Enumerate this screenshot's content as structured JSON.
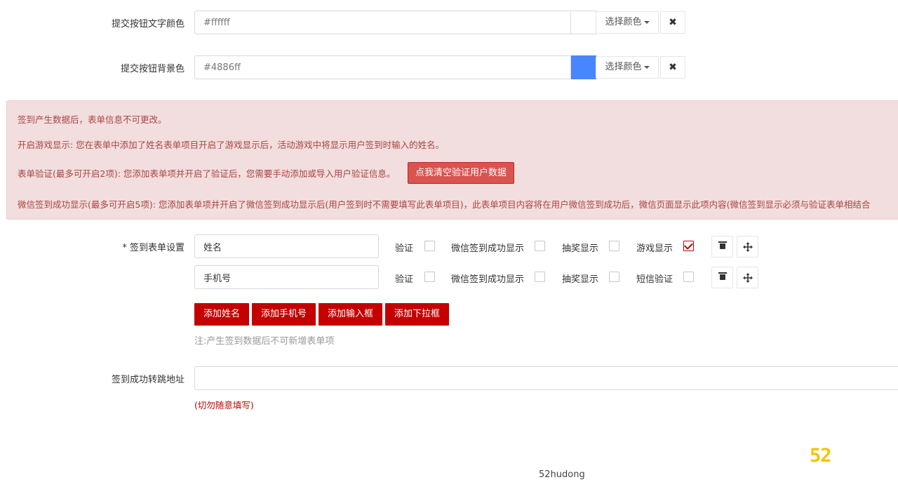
{
  "colors": {
    "accent": "#c40000",
    "alert_bg": "#f2dede",
    "alert_text": "#a94442",
    "clear_button": "#d9534f",
    "submit_text_swatch": "#ffffff",
    "submit_bg_swatch": "#4886ff",
    "logo": "#f5c400"
  },
  "submit_text_color": {
    "label": "提交按钮文字颜色",
    "value": "#ffffff",
    "pick_label": "选择颜色",
    "clear_icon": "close-icon"
  },
  "submit_bg_color": {
    "label": "提交按钮背景色",
    "value": "#4886ff",
    "pick_label": "选择颜色",
    "clear_icon": "close-icon"
  },
  "alert": {
    "line1": "签到产生数据后，表单信息不可更改。",
    "line2": "开启游戏显示: 您在表单中添加了姓名表单项目开启了游戏显示后，活动游戏中将显示用户签到时输入的姓名。",
    "line3": "表单验证(最多可开启2项): 您添加表单项并开启了验证后，您需要手动添加或导入用户验证信息。",
    "clear_button": "点我清空验证用户数据",
    "line4": "微信签到成功显示(最多可开启5项): 您添加表单项并开启了微信签到成功显示后(用户签到时不需要填写此表单项目)，此表单项目内容将在用户微信签到成功后，微信页面显示此项内容(微信签到显示必须与验证表单相结合"
  },
  "form_settings": {
    "label": "* 签到表单设置",
    "rows": [
      {
        "field": "姓名",
        "options": [
          {
            "label": "验证",
            "checked": false
          },
          {
            "label": "微信签到成功显示",
            "checked": false
          },
          {
            "label": "抽奖显示",
            "checked": false
          },
          {
            "label": "游戏显示",
            "checked": true
          }
        ]
      },
      {
        "field": "手机号",
        "options": [
          {
            "label": "验证",
            "checked": false
          },
          {
            "label": "微信签到成功显示",
            "checked": false
          },
          {
            "label": "抽奖显示",
            "checked": false
          },
          {
            "label": "短信验证",
            "checked": false
          }
        ]
      }
    ],
    "add_buttons": [
      "添加姓名",
      "添加手机号",
      "添加输入框",
      "添加下拉框"
    ],
    "note": "注:产生签到数据后不可新增表单项"
  },
  "redirect": {
    "label": "签到成功转跳地址",
    "value": "",
    "warning": "(切勿随意填写)"
  },
  "watermark": {
    "logo_text": "52",
    "site": "52hudong"
  }
}
